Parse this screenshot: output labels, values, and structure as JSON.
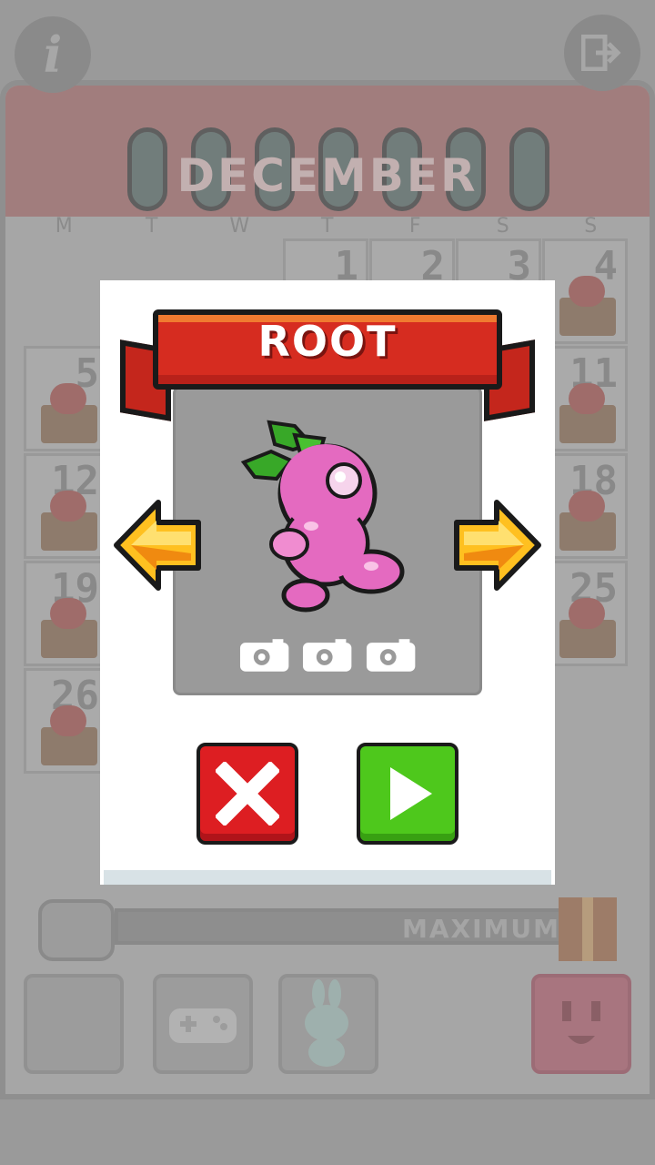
{
  "background": {
    "month": "DECEMBER",
    "weekdays": [
      "M",
      "T",
      "W",
      "T",
      "F",
      "S",
      "S"
    ],
    "days": [
      {
        "label": "1",
        "col": 3,
        "row": 0
      },
      {
        "label": "2",
        "col": 4,
        "row": 0
      },
      {
        "label": "3",
        "col": 5,
        "row": 0
      },
      {
        "label": "4",
        "col": 6,
        "row": 0
      },
      {
        "label": "5",
        "col": 0,
        "row": 1
      },
      {
        "label": "11",
        "col": 6,
        "row": 1
      },
      {
        "label": "12",
        "col": 0,
        "row": 2
      },
      {
        "label": "18",
        "col": 6,
        "row": 2
      },
      {
        "label": "19",
        "col": 0,
        "row": 3
      },
      {
        "label": "25",
        "col": 6,
        "row": 3
      },
      {
        "label": "26",
        "col": 0,
        "row": 4
      }
    ],
    "progress_label": "MAXIMUM",
    "info_icon": "i"
  },
  "modal": {
    "title": "ROOT",
    "left_arrow": "previous-arrow",
    "right_arrow": "next-arrow",
    "camera_count": 3,
    "cancel_icon": "close-x-icon",
    "play_icon": "play-icon"
  },
  "colors": {
    "ribbon_red": "#d62c20",
    "cancel_red": "#dd1e22",
    "play_green": "#4ec81c",
    "arrow_yellow": "#ffc020",
    "character_pink": "#e46ac0",
    "leaf_green": "#38a828"
  }
}
